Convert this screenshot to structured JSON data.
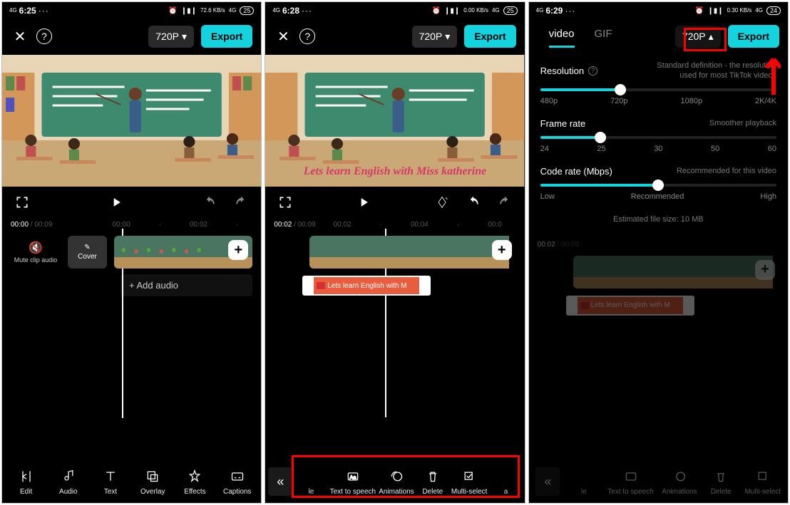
{
  "status": {
    "nets": [
      "4G",
      "4G"
    ],
    "time1": "6:25",
    "time2": "6:28",
    "time3": "6:29",
    "dots": "···",
    "alarm": "⏰",
    "vib": "⟰",
    "speed1": "72.6\nKB/s",
    "speed2": "0.00\nKB/s",
    "speed3": "0.30\nKB/s",
    "sig": "4G",
    "batt": "25",
    "batt2": "24"
  },
  "top": {
    "res": "720P",
    "arrdown": "▾",
    "arrup": "▴",
    "export": "Export"
  },
  "caption": "Lets learn English with Miss katherine",
  "time1": {
    "cur": "00:00",
    "total": "00:09",
    "ticks": [
      "00:00",
      "·",
      "00:02",
      "·"
    ]
  },
  "time2": {
    "cur": "00:02",
    "total": "00:09",
    "ticks": [
      "00:02",
      "·",
      "00:04",
      "·",
      "00:0"
    ]
  },
  "mute": "Mute clip audio",
  "cover": "Cover",
  "addaudio": "+  Add audio",
  "textclip": "Lets learn English with M",
  "bottom1": [
    {
      "name": "edit",
      "label": "Edit"
    },
    {
      "name": "audio",
      "label": "Audio"
    },
    {
      "name": "text",
      "label": "Text"
    },
    {
      "name": "overlay",
      "label": "Overlay"
    },
    {
      "name": "effects",
      "label": "Effects"
    },
    {
      "name": "captions",
      "label": "Captions"
    }
  ],
  "bottom2": {
    "partial_left": "le",
    "items": [
      {
        "name": "tts",
        "label": "Text to speech"
      },
      {
        "name": "anim",
        "label": "Animations"
      },
      {
        "name": "delete",
        "label": "Delete"
      },
      {
        "name": "multi",
        "label": "Multi-select"
      }
    ],
    "partial_right": "a"
  },
  "export_panel": {
    "tabs": [
      "video",
      "GIF"
    ],
    "resolution": {
      "label": "Resolution",
      "hint": "Standard definition - the resolution used for most TikTok videos",
      "ticks": [
        "480p",
        "720p",
        "1080p",
        "2K/4K"
      ],
      "pos": 34
    },
    "framerate": {
      "label": "Frame rate",
      "hint": "Smoother playback",
      "ticks": [
        "24",
        "25",
        "30",
        "50",
        "60"
      ],
      "pos": 25
    },
    "coderate": {
      "label": "Code rate (Mbps)",
      "hint": "Recommended for this video",
      "ticks": [
        "Low",
        "Recommended",
        "High"
      ],
      "pos": 50
    },
    "estimate": "Estimated file size: 10 MB"
  }
}
